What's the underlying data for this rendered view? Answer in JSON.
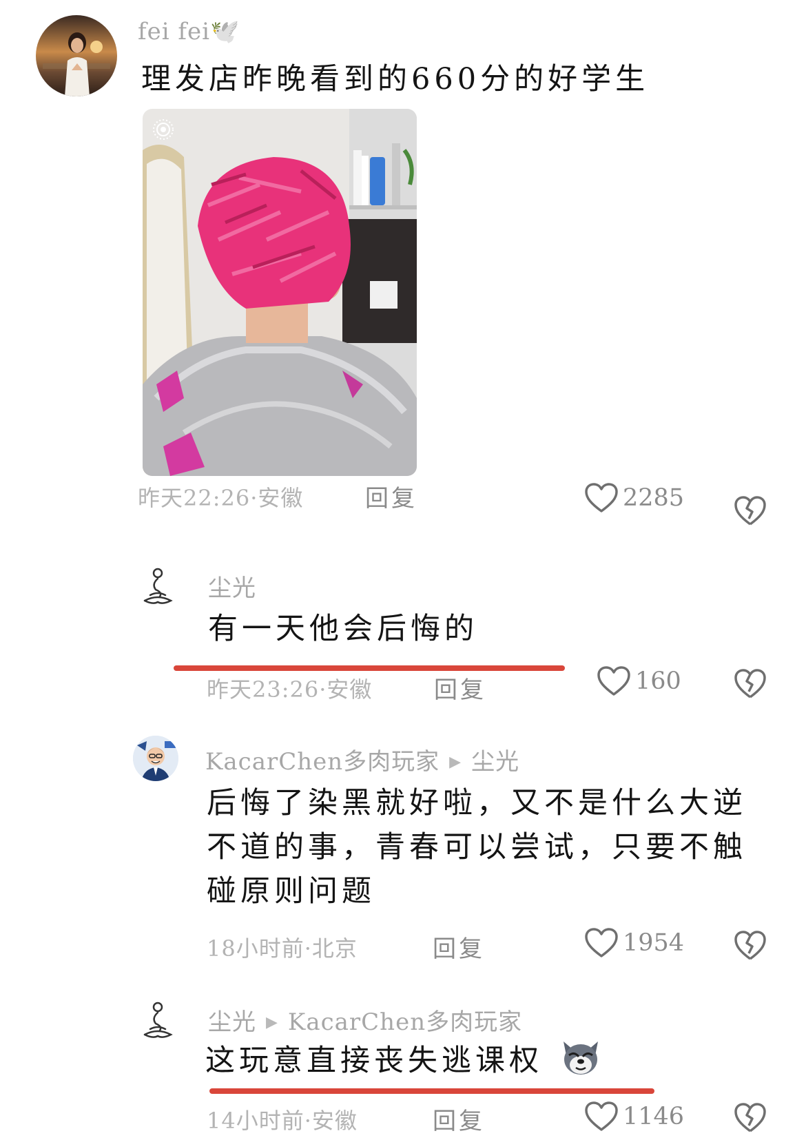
{
  "comments": [
    {
      "username": "fei fei🕊️",
      "text": "理发店昨晚看到的660分的好学生",
      "meta": "昨天22:26·安徽",
      "reply_label": "回复",
      "likes": "2285",
      "has_image": true
    },
    {
      "username": "尘光",
      "text": "有一天他会后悔的",
      "meta": "昨天23:26·安徽",
      "reply_label": "回复",
      "likes": "160",
      "underline": true
    },
    {
      "username": "KacarChen多肉玩家",
      "reply_to": "尘光",
      "text": "后悔了染黑就好啦，又不是什么大逆不道的事，青春可以尝试，只要不触碰原则问题",
      "meta": "18小时前·北京",
      "reply_label": "回复",
      "likes": "1954"
    },
    {
      "username": "尘光",
      "reply_to": "KacarChen多肉玩家",
      "text": "这玩意直接丧失逃课权",
      "emoji": "dog-face-emoji",
      "meta": "14小时前·安徽",
      "reply_label": "回复",
      "likes": "1146",
      "underline": true
    }
  ],
  "colors": {
    "underline": "#d9463a",
    "hair": "#e8327a",
    "meta_text": "#b3b3b3",
    "icon_stroke": "#6f6f6f"
  },
  "icons": {
    "like": "heart-outline-icon",
    "dislike": "broken-heart-icon",
    "reply_arrow": "triangle-right-icon",
    "photo_badge": "live-photo-icon"
  }
}
